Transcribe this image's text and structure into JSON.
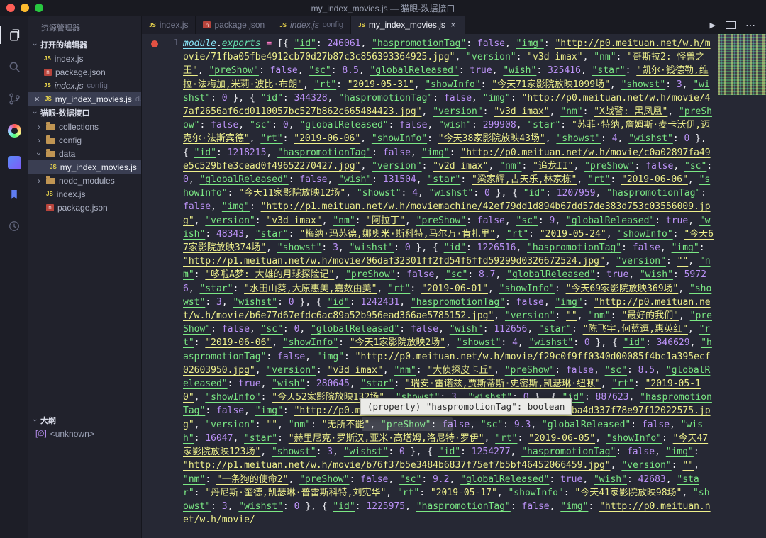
{
  "titlebar": {
    "title": "my_index_movies.js — 猫眼-数据接口"
  },
  "icons": {
    "js": "JS",
    "npm": "n",
    "chevron": "›",
    "close": "×",
    "play": "▶",
    "more": "⋯",
    "symbol_unknown": "[∅]"
  },
  "sidebar": {
    "title": "资源管理器",
    "open_editors": {
      "header": "打开的编辑器",
      "items": [
        {
          "label": "index.js"
        },
        {
          "label": "package.json"
        },
        {
          "label": "index.js",
          "dir": "config"
        },
        {
          "label": "my_index_movies.js",
          "dir": "d..."
        }
      ]
    },
    "project": {
      "header": "猫眼-数据接口",
      "items": [
        {
          "label": "collections"
        },
        {
          "label": "config"
        },
        {
          "label": "data"
        },
        {
          "label": "my_index_movies.js"
        },
        {
          "label": "node_modules"
        },
        {
          "label": "index.js"
        },
        {
          "label": "package.json"
        }
      ]
    },
    "outline": {
      "header": "大纲",
      "items": [
        {
          "label": "<unknown>"
        }
      ]
    }
  },
  "tabs": [
    {
      "label": "index.js"
    },
    {
      "label": "package.json"
    },
    {
      "label": "index.js",
      "dir": "config"
    },
    {
      "label": "my_index_movies.js"
    }
  ],
  "editor": {
    "line_number": "1",
    "code": "module.exports = [{ \"id\": 246061, \"haspromotionTag\": false, \"img\": \"http://p0.meituan.net/w.h/movie/71fba05fbe4912cb70d27b87c3c856393364925.jpg\", \"version\": \"v3d imax\", \"nm\": \"哥斯拉2: 怪兽之王\", \"preShow\": false, \"sc\": 8.5, \"globalReleased\": true, \"wish\": 325416, \"star\": \"凯尔·钱德勒,维拉·法梅加,米莉·波比·布朗\", \"rt\": \"2019-05-31\", \"showInfo\": \"今天71家影院放映1099场\", \"showst\": 3, \"wishst\": 0 }, { \"id\": 344328, \"haspromotionTag\": false, \"img\": \"http://p0.meituan.net/w.h/movie/47af2656af6cd0110057bc527b862c665484423.jpg\", \"version\": \"v3d imax\", \"nm\": \"X战警: 黑凤凰\", \"preShow\": false, \"sc\": 0, \"globalReleased\": false, \"wish\": 299908, \"star\": \"苏菲·特纳,詹姆斯·麦卡沃伊,迈克尔·法斯宾德\", \"rt\": \"2019-06-06\", \"showInfo\": \"今天38家影院放映43场\", \"showst\": 4, \"wishst\": 0 }, { \"id\": 1218215, \"haspromotionTag\": false, \"img\": \"http://p0.meituan.net/w.h/movie/c0a02897fa49e5c529bfe3cead0f49652270427.jpg\", \"version\": \"v2d imax\", \"nm\": \"追龙II\", \"preShow\": false, \"sc\": 0, \"globalReleased\": false, \"wish\": 131504, \"star\": \"梁家辉,古天乐,林家栋\", \"rt\": \"2019-06-06\", \"showInfo\": \"今天11家影院放映12场\", \"showst\": 4, \"wishst\": 0 }, { \"id\": 1207959, \"haspromotionTag\": false, \"img\": \"http://p1.meituan.net/w.h/moviemachine/42ef79dd1d894b67dd57de383d753c03556009.jpg\", \"version\": \"v3d imax\", \"nm\": \"阿拉丁\", \"preShow\": false, \"sc\": 9, \"globalReleased\": true, \"wish\": 48343, \"star\": \"梅纳·玛苏德,娜奥米·斯科特,马尔万·肯扎里\", \"rt\": \"2019-05-24\", \"showInfo\": \"今天67家影院放映374场\", \"showst\": 3, \"wishst\": 0 }, { \"id\": 1226516, \"haspromotionTag\": false, \"img\": \"http://p1.meituan.net/w.h/movie/06daf32301ff2fd54f6ffd59299d0326672524.jpg\", \"version\": \"\", \"nm\": \"哆啦A梦: 大雄的月球探险记\", \"preShow\": false, \"sc\": 8.7, \"globalReleased\": true, \"wish\": 59726, \"star\": \"水田山葵,大原惠美,嘉数由美\", \"rt\": \"2019-06-01\", \"showInfo\": \"今天69家影院放映369场\", \"showst\": 3, \"wishst\": 0 }, { \"id\": 1242431, \"haspromotionTag\": false, \"img\": \"http://p0.meituan.net/w.h/movie/b6e77d67efdc6ac89a52b956ead366ae5785152.jpg\", \"version\": \"\", \"nm\": \"最好的我们\", \"preShow\": false, \"sc\": 0, \"globalReleased\": false, \"wish\": 112656, \"star\": \"陈飞宇,何蓝逗,惠英红\", \"rt\": \"2019-06-06\", \"showInfo\": \"今天1家影院放映2场\", \"showst\": 4, \"wishst\": 0 }, { \"id\": 346629, \"haspromotionTag\": false, \"img\": \"http://p0.meituan.net/w.h/movie/f29c0f9ff0340d00085f4bc1a395ecf02603950.jpg\", \"version\": \"v3d imax\", \"nm\": \"大侦探皮卡丘\", \"preShow\": false, \"sc\": 8.5, \"globalReleased\": true, \"wish\": 280645, \"star\": \"瑞安·雷诺兹,贾斯蒂斯·史密斯,凯瑟琳·纽顿\", \"rt\": \"2019-05-10\", \"showInfo\": \"今天52家影院放映132场\", \"showst\": 3, \"wishst\": 0 }, { \"id\": 887623, \"haspromotionTag\": false, \"img\": \"http://p0.meituan.net/w.h/movie/36b245c374ec10f6aba4d337f78e97f12022575.jpg\", \"version\": \"\", \"nm\": \"无所不能\", \"preShow\": false, \"sc\": 9.3, \"globalReleased\": false, \"wish\": 16047, \"star\": \"赫里尼克·罗斯汉,亚米·高塔姆,洛尼特·罗伊\", \"rt\": \"2019-06-05\", \"showInfo\": \"今天47家影院放映123场\", \"showst\": 3, \"wishst\": 0 }, { \"id\": 1254277, \"haspromotionTag\": false, \"img\": \"http://p1.meituan.net/w.h/movie/b76f37b5e3484b6837f75ef7b5bf46452066459.jpg\", \"version\": \"\", \"nm\": \"一条狗的使命2\", \"preShow\": false, \"sc\": 9.2, \"globalReleased\": true, \"wish\": 42683, \"star\": \"丹尼斯·奎德,凯瑟琳·普雷斯科特,刘宪华\", \"rt\": \"2019-05-17\", \"showInfo\": \"今天41家影院放映98场\", \"showst\": 3, \"wishst\": 0 }, { \"id\": 1225975, \"haspromotionTag\": false, \"img\": \"http://p0.meituan.net/w.h/movie/"
  },
  "tooltip": {
    "text": "(property) \"haspromotionTag\": boolean"
  },
  "colors": {
    "editor_bg": "#262834",
    "sidebar_bg": "#21222c",
    "titlebar_bg": "#191a21",
    "string": "#eef08b",
    "key": "#7be884",
    "number": "#bd93f9",
    "breakpoint": "#e35143",
    "folder_icon": "#c09553",
    "js_icon": "#e8d44d",
    "npm_icon": "#b8443c"
  }
}
